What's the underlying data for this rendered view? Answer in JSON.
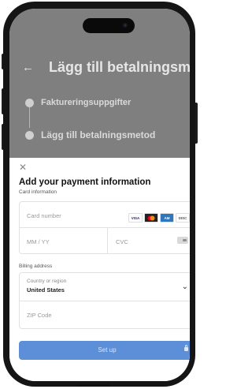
{
  "background_page": {
    "title": "Lägg till betalningsmet",
    "steps": [
      {
        "label": "Faktureringsuppgifter"
      },
      {
        "label": "Lägg till betalningsmetod"
      }
    ]
  },
  "sheet": {
    "title": "Add your payment information",
    "card_info_label": "Card information",
    "card_number_placeholder": "Card number",
    "expiry_placeholder": "MM / YY",
    "cvc_placeholder": "CVC",
    "card_brands": [
      "VISA",
      "MC",
      "AMEX",
      "DISC"
    ],
    "billing_label": "Billing address",
    "country_label": "Country or region",
    "country_value": "United States",
    "zip_placeholder": "ZIP Code",
    "submit_label": "Set up"
  },
  "colors": {
    "accent": "#5d8fd8",
    "overlay": "#7f7f7f"
  },
  "icons": {
    "close": "close-icon",
    "back": "arrow-left-icon",
    "chevron": "chevron-down-icon",
    "lock": "lock-icon"
  }
}
